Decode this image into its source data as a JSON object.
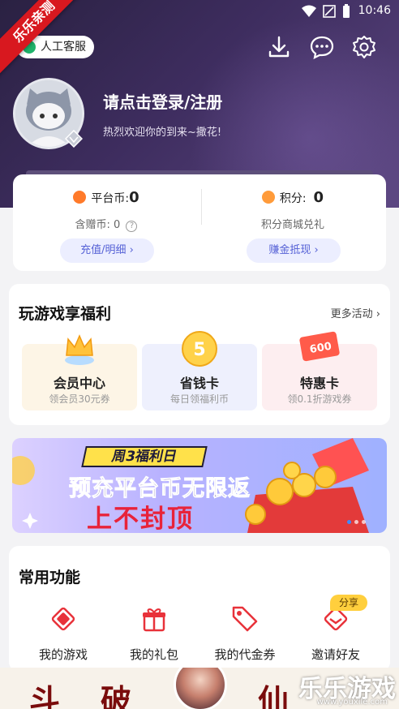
{
  "status_bar": {
    "time": "10:46"
  },
  "ribbon": {
    "text": "乐乐亲测"
  },
  "header": {
    "service_label": "人工客服",
    "login_title": "请点击登录/注册",
    "login_subtitle": "热烈欢迎你的到来~撒花!"
  },
  "wallet": {
    "left": {
      "title": "平台币:",
      "value": "0",
      "sub_label": "含赠币:",
      "sub_value": "0",
      "button": "充值/明细"
    },
    "right": {
      "title": "积分:",
      "value": "0",
      "sub_label": "积分商城兑礼",
      "button": "赚金抵现"
    }
  },
  "welfare": {
    "title": "玩游戏享福利",
    "more": "更多活动",
    "cards": [
      {
        "name": "会员中心",
        "desc": "领会员30元券",
        "bg": "#fdf5e6"
      },
      {
        "name": "省钱卡",
        "desc": "每日领福利币",
        "bg": "#eef0fd",
        "badge": "5"
      },
      {
        "name": "特惠卡",
        "desc": "领0.1折游戏券",
        "bg": "#fdeef0",
        "badge": "600"
      }
    ]
  },
  "banner": {
    "tag": "周3福利日",
    "line1": "预充平台币无限返",
    "line2": "上不封顶"
  },
  "common": {
    "title": "常用功能",
    "items": [
      {
        "label": "我的游戏",
        "icon": "game-icon"
      },
      {
        "label": "我的礼包",
        "icon": "gift-icon"
      },
      {
        "label": "我的代金券",
        "icon": "voucher-icon"
      },
      {
        "label": "邀请好友",
        "icon": "invite-icon"
      }
    ],
    "share_tag": "分享"
  },
  "bottom_ad": {
    "chars": [
      "斗",
      "破",
      "仙"
    ]
  },
  "watermark": {
    "text": "乐乐游戏",
    "url": "www.youxile.com"
  },
  "colors": {
    "accent": "#5561d6",
    "header_dark": "#2a2142",
    "ribbon": "#d8181f",
    "icon_red": "#e8323a"
  }
}
